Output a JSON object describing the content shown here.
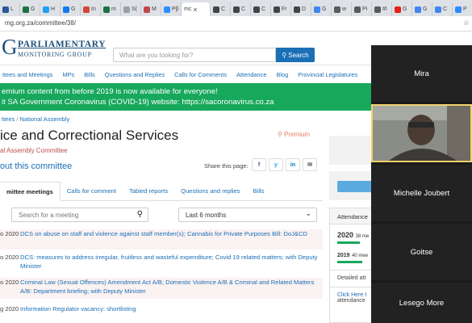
{
  "browser": {
    "tabs": [
      {
        "label": "L",
        "fav": "#2b579a"
      },
      {
        "label": "G",
        "fav": "#1e7145"
      },
      {
        "label": "H",
        "fav": "#1da1f2"
      },
      {
        "label": "G",
        "fav": "#1877f2"
      },
      {
        "label": "In",
        "fav": "#d44638"
      },
      {
        "label": "m",
        "fav": "#1e7145"
      },
      {
        "label": "S(",
        "fav": "#9aa0a6"
      },
      {
        "label": "M",
        "fav": "#c04848"
      },
      {
        "label": "Pβ",
        "fav": "#2d8cff"
      }
    ],
    "active_tab": {
      "label": "mc",
      "close": "×"
    },
    "tabs_after": [
      {
        "label": "C",
        "fav": "#444"
      },
      {
        "label": "C",
        "fav": "#444"
      },
      {
        "label": "C",
        "fav": "#444"
      },
      {
        "label": "Fr",
        "fav": "#444"
      },
      {
        "label": "D",
        "fav": "#444"
      },
      {
        "label": "G",
        "fav": "#4285f4"
      },
      {
        "label": "w",
        "fav": "#5a5a5a"
      },
      {
        "label": "Pi",
        "fav": "#5a5a5a"
      },
      {
        "label": "#I",
        "fav": "#5a5a5a"
      },
      {
        "label": "G",
        "fav": "#e62117"
      },
      {
        "label": "G",
        "fav": "#4285f4"
      },
      {
        "label": "C",
        "fav": "#4285f4"
      },
      {
        "label": "P",
        "fav": "#2d8cff"
      }
    ],
    "new_tab": "+",
    "url": "mg.org.za/committee/38/",
    "bookmark_icon": "star-icon"
  },
  "site": {
    "logo_g": "G",
    "logo_line1": "PARLIAMENTARY",
    "logo_line2": "MONITORING GROUP",
    "search_placeholder": "What are you looking for?",
    "search_button": "Search",
    "nav": [
      "ttees and Meetings",
      "MPs",
      "Bills",
      "Questions and Replies",
      "Calls for Comments",
      "Attendance",
      "Blog",
      "Provincial Legislatures"
    ],
    "banner_line1": "emium content from before 2019 is now available for everyone!",
    "banner_line2": "it SA Government Coronavirus (COVID-19) website: https://sacoronavirus.co.za",
    "breadcrumb_1": "ttees",
    "breadcrumb_sep": "/",
    "breadcrumb_2": "National Assembly",
    "title": "ice and Correctional Services",
    "premium": "Premium",
    "subtitle": "al Assembly Committee",
    "about": "out this committee",
    "share_label": "Share this page:",
    "share_buttons": [
      "f",
      "y",
      "in",
      "✉"
    ],
    "page_tabs": [
      "mittee meetings",
      "Calls for comment",
      "Tabled reports",
      "Questions and replies",
      "Bills"
    ],
    "meeting_search_placeholder": "Search for a meeting",
    "period": "Last 6 months",
    "meetings": [
      {
        "date": "2020",
        "title": "DCS on abuse on staff and violence against staff member(s); Cannabis for Private Purposes Bill: DoJ&CD"
      },
      {
        "date": "2020",
        "title": "DCS: measures to address irregular, fruitless and wasteful expenditure; Covid 19 related matters; with Deputy Minister"
      },
      {
        "date": "2020",
        "title": "Criminal Law (Sexual Offences) Amendment Act A/B; Domestic Violence A/B & Criminal and Related Matters A/B: Department briefing; with Deputy Minister"
      },
      {
        "date": "2020",
        "title": "Information Regulator vacancy: shortlisting"
      }
    ],
    "meeting_date_prefixes": [
      "o",
      "o",
      "o",
      "g"
    ],
    "attendance_title": "Attendance",
    "attendance_years": [
      {
        "year": "2020",
        "note": "38 me",
        "fill": 0.55
      },
      {
        "year": "2019",
        "note": "40 mee",
        "fill": 0.6
      }
    ],
    "attendance_detail": "Detailed att",
    "attendance_link": "Click Here t",
    "attendance_link2": "attendance"
  },
  "meeting_panel": {
    "participants": [
      {
        "name": "Mira",
        "video": false
      },
      {
        "name": "",
        "video": true
      },
      {
        "name": "Michelle Joubert",
        "video": false
      },
      {
        "name": "Goitse",
        "video": false
      },
      {
        "name": "Lesego More",
        "video": false
      }
    ]
  }
}
